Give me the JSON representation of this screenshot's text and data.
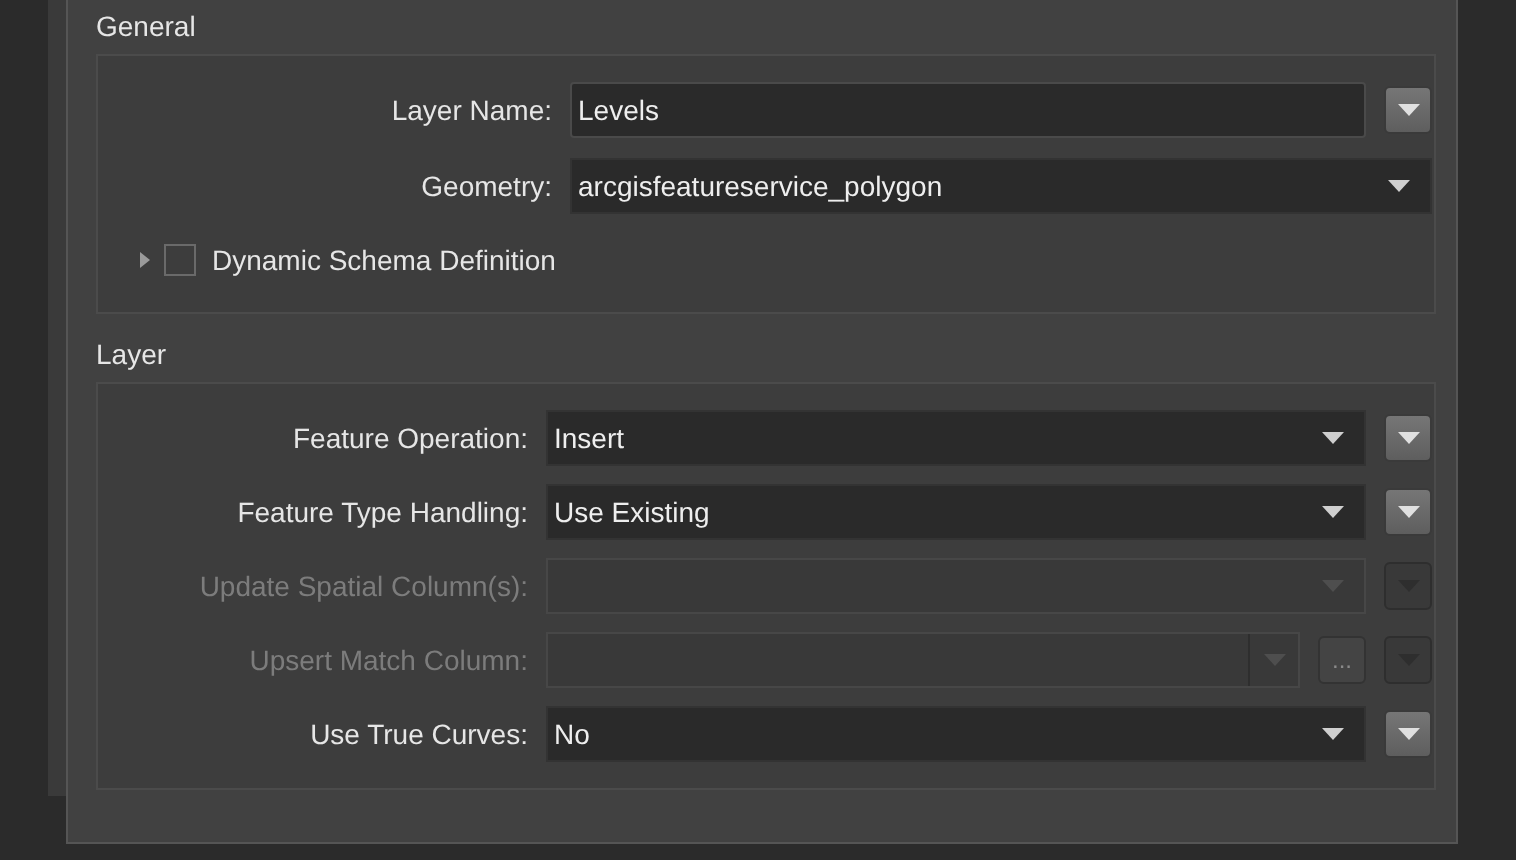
{
  "sections": [
    {
      "title": "General",
      "rows": [
        {
          "kind": "text",
          "label": "Layer Name:",
          "value": "Levels",
          "disabled": false
        },
        {
          "kind": "combo",
          "label": "Geometry:",
          "value": "arcgisfeatureservice_polygon",
          "disabled": false
        },
        {
          "kind": "checkbox",
          "label": "Dynamic Schema Definition",
          "checked": false,
          "expanded": false
        }
      ]
    },
    {
      "title": "Layer",
      "rows": [
        {
          "kind": "combo_menu",
          "label": "Feature Operation:",
          "value": "Insert",
          "disabled": false
        },
        {
          "kind": "combo_menu",
          "label": "Feature Type Handling:",
          "value": "Use Existing",
          "disabled": false
        },
        {
          "kind": "combo_menu",
          "label": "Update Spatial Column(s):",
          "value": "",
          "disabled": true
        },
        {
          "kind": "combo_browse",
          "label": "Upsert Match Column:",
          "value": "",
          "browse": "...",
          "disabled": true
        },
        {
          "kind": "combo_menu",
          "label": "Use True Curves:",
          "value": "No",
          "disabled": false
        }
      ]
    }
  ]
}
